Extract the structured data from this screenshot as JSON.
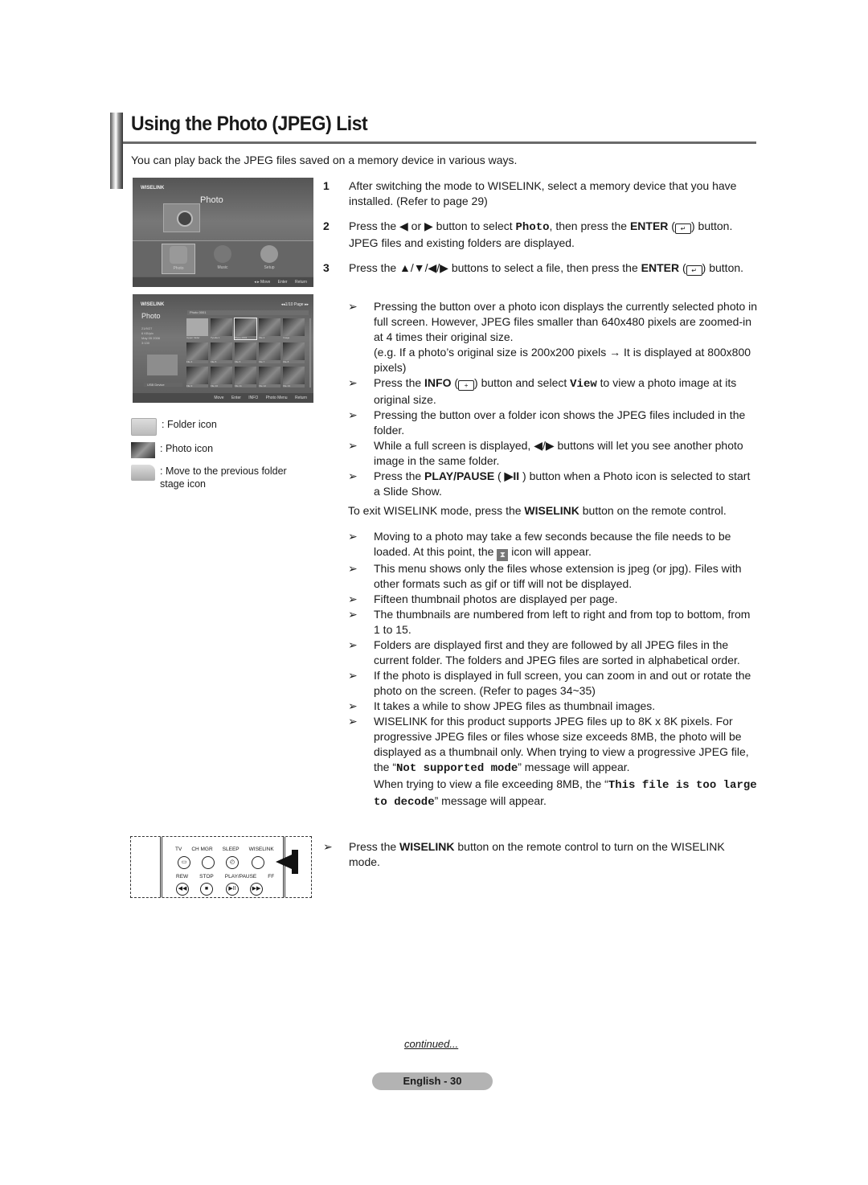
{
  "header": {
    "title": "Using the Photo (JPEG) List",
    "intro": "You can play back the JPEG files saved on a memory device in various ways."
  },
  "screenshot1": {
    "brand": "WISELINK",
    "hero_title": "Photo",
    "menu_items": [
      "Photo",
      "Music",
      "Setup"
    ],
    "footer": [
      "◂ ▸ Move",
      "Enter",
      "Return"
    ]
  },
  "screenshot2": {
    "brand": "WISELINK",
    "left_title": "Photo",
    "info": "21/9/27\n6 KB/pix\nMay 05 2006\n3:130",
    "device": "USB Device",
    "page": "◂◂1/10 Page ▸▸",
    "path": "Photo 0001",
    "thumbs": [
      "Upper folder",
      "Tyrolia 1",
      "Photo 0001",
      "File 2",
      "Image",
      "File 4",
      "File 5",
      "File 6",
      "File 7",
      "File 8",
      "File 9",
      "File 10",
      "File 11",
      "File 12",
      "File 13"
    ],
    "footer": [
      "Move",
      "Enter",
      "INFO",
      "Photo Menu",
      "Return"
    ]
  },
  "legend": [
    {
      "icon": "folder-icon",
      "label": ": Folder icon"
    },
    {
      "icon": "photo-icon",
      "label": ": Photo icon"
    },
    {
      "icon": "previous-folder-icon",
      "label": ": Move to the previous folder stage icon"
    }
  ],
  "steps": [
    {
      "num": "1",
      "text": "After switching the mode to WISELINK, select a memory device that you have installed. (Refer to page 29)"
    },
    {
      "num": "2",
      "pre": "Press the ◀ or ▶ button to select ",
      "mono": "Photo",
      "mid": ", then press the ",
      "bold": "ENTER",
      "post": " button. JPEG files and existing folders are displayed."
    },
    {
      "num": "3",
      "pre": "Press the ▲/▼/◀/▶ buttons to select a file, then press the ",
      "bold": "ENTER",
      "post": " button."
    }
  ],
  "notes1": {
    "n1": "Pressing the button over a photo icon displays the currently selected photo in full screen. However, JPEG files smaller than 640x480 pixels are zoomed-in at 4 times their original size.",
    "n1b": "(e.g. If a photo’s original size is 200x200 pixels → It is displayed at 800x800 pixels)",
    "n2_pre": "Press the ",
    "n2_bold": "INFO",
    "n2_mid": " button and select ",
    "n2_mono": "View",
    "n2_post": " to view a photo image at its original size.",
    "n3": "Pressing the button over a folder icon shows the JPEG files included in the folder.",
    "n4": "While a full screen is displayed, ◀/▶ buttons will let you see another photo image in the same folder.",
    "n5_pre": "Press the ",
    "n5_bold": "PLAY/PAUSE",
    "n5_key": "▶II",
    "n5_post": " button when a Photo icon is selected to start a Slide Show."
  },
  "exit": {
    "pre": "To exit WISELINK mode, press the ",
    "bold": "WISELINK",
    "post": " button on the remote control."
  },
  "notes2": {
    "n1_pre": "Moving to a photo may take a few seconds because the file needs to be loaded. At this point, the ",
    "n1_post": " icon will appear.",
    "n2": "This menu shows only the files whose extension is jpeg (or jpg). Files with other formats such as gif or tiff will not be displayed.",
    "n3": "Fifteen thumbnail photos are displayed per page.",
    "n4": "The thumbnails are numbered from left to right and from top to bottom, from 1 to 15.",
    "n5": "Folders are displayed first and they are followed by all JPEG files in the current folder. The folders and JPEG files are sorted in alphabetical order.",
    "n6": "If the photo is displayed in full screen, you can zoom in and out or rotate the photo on the screen. (Refer to pages 34~35)",
    "n7": "It takes a while to show JPEG files as thumbnail images.",
    "n8_a": "WISELINK for this product supports JPEG files up to 8K x 8K pixels. For progressive JPEG files or files whose size exceeds 8MB, the photo will be displayed as a thumbnail only. When trying to view a progressive JPEG file, the “",
    "n8_mono1": "Not supported mode",
    "n8_b": "” message will appear.",
    "n8_c": "When trying to view a file exceeding 8MB, the “",
    "n8_mono2": "This file is too large to decode",
    "n8_d": "” message will appear."
  },
  "remote": {
    "labels_top": [
      "TV",
      "CH MGR",
      "SLEEP",
      "WISELINK"
    ],
    "labels_bottom": [
      "REW",
      "STOP",
      "PLAY/PAUSE",
      "FF"
    ]
  },
  "remote_note": {
    "pre": "Press the ",
    "bold": "WISELINK",
    "post": " button on the remote control to turn on the WISELINK mode."
  },
  "footer": {
    "continued": "continued...",
    "page": "English - 30"
  }
}
